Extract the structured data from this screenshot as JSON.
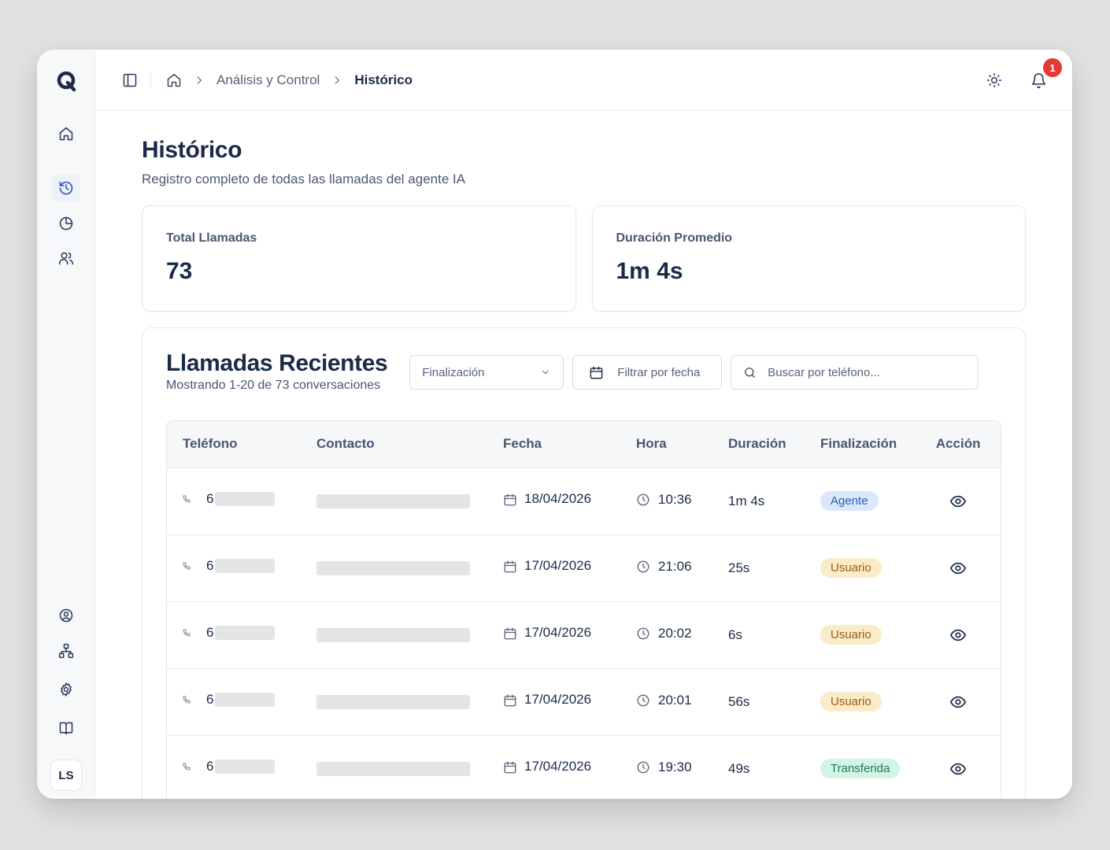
{
  "colors": {
    "accent": "#2552b8",
    "title": "#1b2a47",
    "badge": "#e53935"
  },
  "sidebar": {
    "logo": "q-logo-icon",
    "items": [
      "home-icon",
      "history-icon",
      "pie-chart-icon",
      "users-icon"
    ],
    "bottom_items": [
      "user-circle-icon",
      "network-icon",
      "settings-icon",
      "book-icon"
    ],
    "avatar": "LS"
  },
  "topbar": {
    "breadcrumb": {
      "parent": "Análisis y Control",
      "current": "Histórico"
    },
    "notifications_count": "1"
  },
  "page": {
    "title": "Histórico",
    "subtitle": "Registro completo de todas las llamadas del agente IA"
  },
  "stats": [
    {
      "label": "Total Llamadas",
      "value": "73"
    },
    {
      "label": "Duración Promedio",
      "value": "1m 4s"
    }
  ],
  "calls": {
    "title": "Llamadas Recientes",
    "subtitle": "Mostrando 1-20 de 73 conversaciones",
    "filter_select": "Finalización",
    "filter_date": "Filtrar por fecha",
    "search_placeholder": "Buscar por teléfono...",
    "columns": {
      "phone": "Teléfono",
      "contact": "Contacto",
      "date": "Fecha",
      "time": "Hora",
      "duration": "Duración",
      "end": "Finalización",
      "action": "Acción"
    },
    "rows": [
      {
        "phone": "6",
        "date": "18/04/2026",
        "time": "10:36",
        "duration": "1m 4s",
        "end": "Agente",
        "end_type": "agente"
      },
      {
        "phone": "6",
        "date": "17/04/2026",
        "time": "21:06",
        "duration": "25s",
        "end": "Usuario",
        "end_type": "usuario"
      },
      {
        "phone": "6",
        "date": "17/04/2026",
        "time": "20:02",
        "duration": "6s",
        "end": "Usuario",
        "end_type": "usuario"
      },
      {
        "phone": "6",
        "date": "17/04/2026",
        "time": "20:01",
        "duration": "56s",
        "end": "Usuario",
        "end_type": "usuario"
      },
      {
        "phone": "6",
        "date": "17/04/2026",
        "time": "19:30",
        "duration": "49s",
        "end": "Transferida",
        "end_type": "transferida"
      }
    ]
  }
}
